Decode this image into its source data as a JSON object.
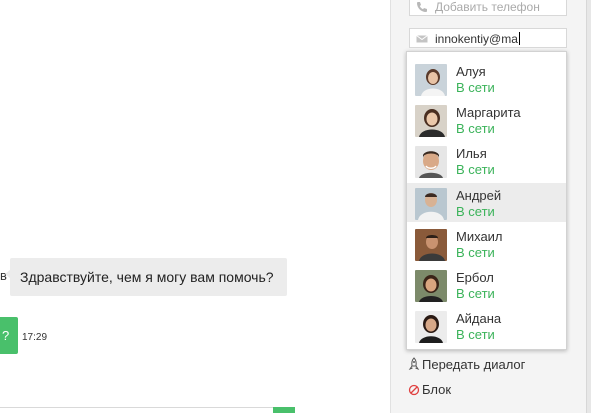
{
  "chat": {
    "partial_prefix": "в",
    "incoming_message": "Здравствуйте, чем я могу вам помочь?",
    "outgoing_partial": "?",
    "time": "17:29"
  },
  "contact": {
    "phone_placeholder": "Добавить телефон",
    "email_value": "innokentiy@ma"
  },
  "operators": [
    {
      "name": "Алуя",
      "status": "В сети",
      "highlighted": false
    },
    {
      "name": "Маргарита",
      "status": "В сети",
      "highlighted": false
    },
    {
      "name": "Илья",
      "status": "В сети",
      "highlighted": false
    },
    {
      "name": "Андрей",
      "status": "В сети",
      "highlighted": true
    },
    {
      "name": "Михаил",
      "status": "В сети",
      "highlighted": false
    },
    {
      "name": "Ербол",
      "status": "В сети",
      "highlighted": false
    },
    {
      "name": "Айдана",
      "status": "В сети",
      "highlighted": false
    }
  ],
  "actions": {
    "transfer_label": "Передать диалог",
    "block_label": "Блок"
  },
  "colors": {
    "online_green": "#3bb35a",
    "bubble_green": "#49c06b",
    "bubble_grey": "#ececec",
    "block_red": "#e04040"
  },
  "icons": {
    "phone": "phone-icon",
    "email": "envelope-icon",
    "transfer": "rocket-icon",
    "block": "block-icon"
  }
}
